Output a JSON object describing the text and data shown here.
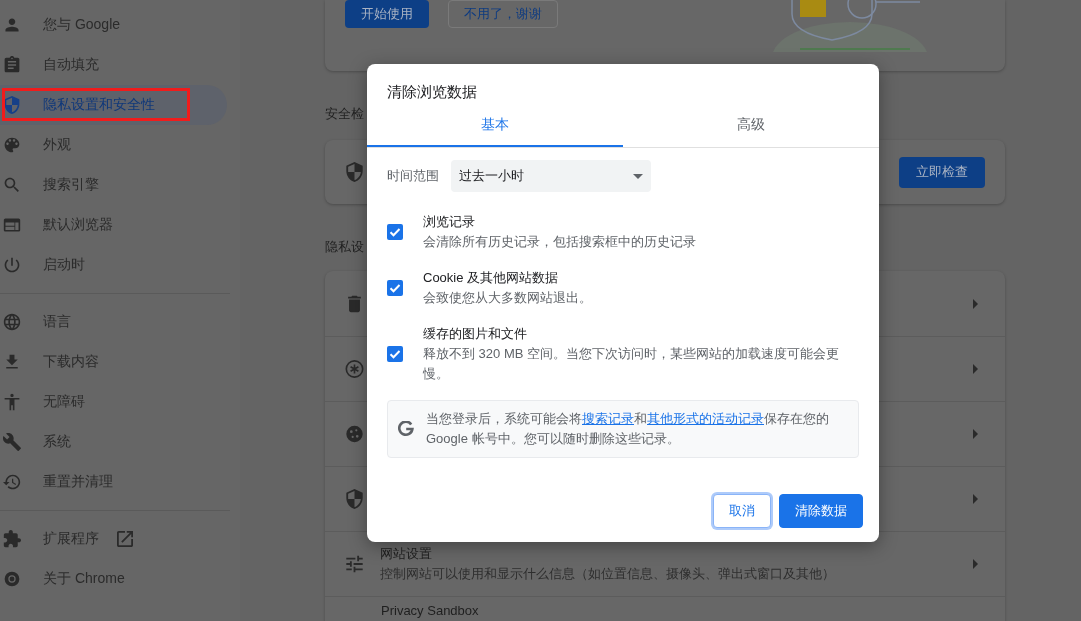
{
  "sidebar": {
    "groups": [
      {
        "items": [
          {
            "label": "您与 Google",
            "selected": false,
            "annotated": false
          },
          {
            "label": "自动填充",
            "selected": false,
            "annotated": false
          },
          {
            "label": "隐私设置和安全性",
            "selected": true,
            "annotated": true
          },
          {
            "label": "外观",
            "selected": false,
            "annotated": false
          },
          {
            "label": "搜索引擎",
            "selected": false,
            "annotated": false
          },
          {
            "label": "默认浏览器",
            "selected": false,
            "annotated": false
          },
          {
            "label": "启动时",
            "selected": false,
            "annotated": false
          }
        ]
      },
      {
        "items": [
          {
            "label": "语言",
            "selected": false,
            "annotated": false
          },
          {
            "label": "下载内容",
            "selected": false,
            "annotated": false
          },
          {
            "label": "无障碍",
            "selected": false,
            "annotated": false
          },
          {
            "label": "系统",
            "selected": false,
            "annotated": false
          },
          {
            "label": "重置并清理",
            "selected": false,
            "annotated": false
          }
        ]
      },
      {
        "items": [
          {
            "label": "扩展程序",
            "selected": false,
            "annotated": false
          },
          {
            "label": "关于 Chrome",
            "selected": false,
            "annotated": false
          }
        ]
      }
    ]
  },
  "page": {
    "promo_card": {
      "buttons": [
        {
          "label": "开始使用",
          "kind": "primary"
        },
        {
          "label": "不用了，谢谢",
          "kind": "secondary"
        }
      ]
    },
    "safety_check": {
      "heading": "安全检",
      "button": {
        "label": "立即检查",
        "kind": "primary"
      }
    },
    "privacy": {
      "heading": "隐私设",
      "rows": [
        {
          "kind": "covered"
        },
        {
          "kind": "covered"
        },
        {
          "kind": "covered"
        },
        {
          "kind": "covered"
        },
        {
          "kind": "setting",
          "title": "网站设置",
          "subtitle": "控制网站可以使用和显示什么信息（如位置信息、摄像头、弹出式窗口及其他）"
        },
        {
          "kind": "setting",
          "title": "Privacy Sandbox"
        }
      ]
    }
  },
  "dialog": {
    "title": "清除浏览数据",
    "tabs": [
      {
        "label": "基本",
        "selected": true
      },
      {
        "label": "高级",
        "selected": false
      }
    ],
    "time_range": {
      "label": "时间范围",
      "value": "过去一小时"
    },
    "options": [
      {
        "title": "浏览记录",
        "description": "会清除所有历史记录，包括搜索框中的历史记录",
        "checked": true
      },
      {
        "title": "Cookie 及其他网站数据",
        "description": "会致使您从大多数网站退出。",
        "checked": true
      },
      {
        "title": "缓存的图片和文件",
        "description": "释放不到 320 MB 空间。当您下次访问时，某些网站的加载速度可能会更慢。",
        "checked": true
      }
    ],
    "notice": [
      {
        "kind": "text",
        "text": "当您登录后，系统可能会将"
      },
      {
        "kind": "link",
        "text": "搜索记录"
      },
      {
        "kind": "text",
        "text": "和"
      },
      {
        "kind": "link",
        "text": "其他形式的活动记录"
      },
      {
        "kind": "text",
        "text": "保存在您的 Google 帐号中。您可以随时删除这些记录。"
      }
    ],
    "buttons": [
      {
        "label": "取消",
        "kind": "secondary",
        "focused": true
      },
      {
        "label": "清除数据",
        "kind": "primary",
        "focused": false
      }
    ]
  }
}
